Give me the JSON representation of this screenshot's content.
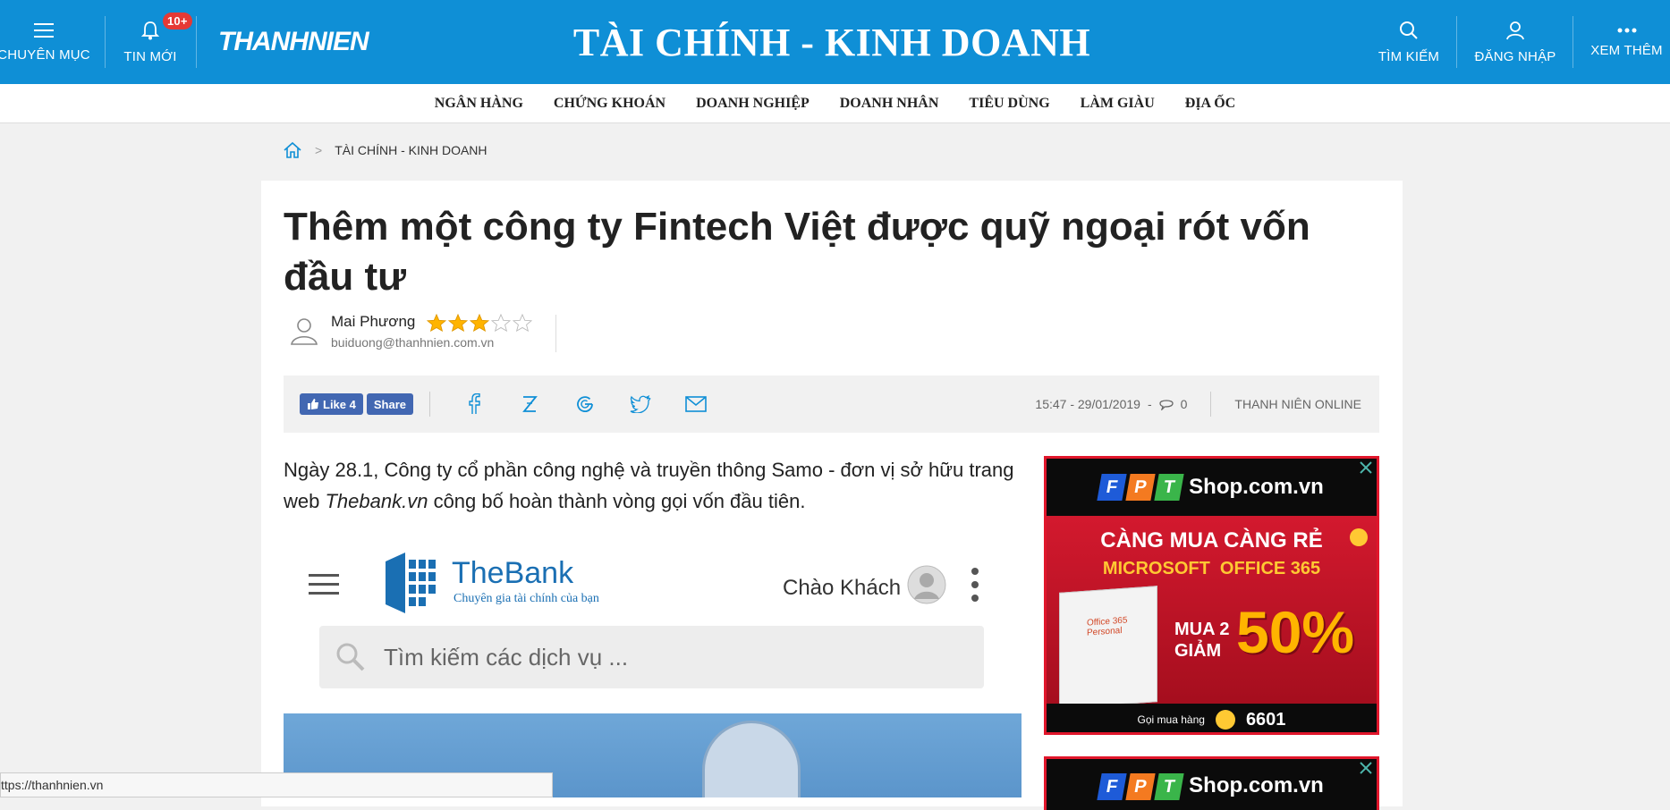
{
  "header": {
    "menu_label": "CHUYÊN MỤC",
    "news_label": "TIN MỚI",
    "news_badge": "10+",
    "logo": "THANHNIEN",
    "section_title": "TÀI CHÍNH - KINH DOANH",
    "search_label": "TÌM KIẾM",
    "login_label": "ĐĂNG NHẬP",
    "more_label": "XEM THÊM"
  },
  "subnav": {
    "items": [
      "NGÂN HÀNG",
      "CHỨNG KHOÁN",
      "DOANH NGHIỆP",
      "DOANH NHÂN",
      "TIÊU DÙNG",
      "LÀM GIÀU",
      "ĐỊA ỐC"
    ]
  },
  "breadcrumb": {
    "sep": ">",
    "current": "TÀI CHÍNH - KINH DOANH"
  },
  "article": {
    "title": "Thêm một công ty Fintech Việt được quỹ ngoại rót vốn đầu tư",
    "author_name": "Mai Phương",
    "author_email": "buiduong@thanhnien.com.vn",
    "rating": 3,
    "rating_max": 5,
    "fb_like": "Like 4",
    "fb_share": "Share",
    "datetime": "15:47 - 29/01/2019",
    "dash": "-",
    "comments": "0",
    "source": "THANH NIÊN ONLINE",
    "sapo_start": "Ngày 28.1, Công ty cổ phần công nghệ và truyền thông Samo - đơn vị sở hữu trang web ",
    "sapo_link": "Thebank.vn",
    "sapo_end": " công bố hoàn thành vòng gọi vốn đầu tiên."
  },
  "image": {
    "brand": "TheBank",
    "tagline": "Chuyên gia tài chính của bạn",
    "greeting": "Chào Khách",
    "search_placeholder": "Tìm kiếm các dịch vụ ..."
  },
  "ads": [
    {
      "brand": "FPT",
      "shop": "Shop.com.vn",
      "headline": "CÀNG MUA CÀNG RẺ",
      "product": "MICROSOFT  OFFICE 365",
      "buy": "MUA 2",
      "discount_word": "GIẢM",
      "discount": "50%",
      "box_label": "Office 365 Personal",
      "hotline_label": "Gọi mua hàng",
      "hotline": "6601"
    },
    {
      "brand": "FPT",
      "shop": "Shop.com.vn"
    }
  ],
  "status_bar": {
    "url": "ttps://thanhnien.vn"
  },
  "colors": {
    "header_blue": "#0f8fd6",
    "ad_red": "#c8102e",
    "gold": "#ffb400"
  }
}
